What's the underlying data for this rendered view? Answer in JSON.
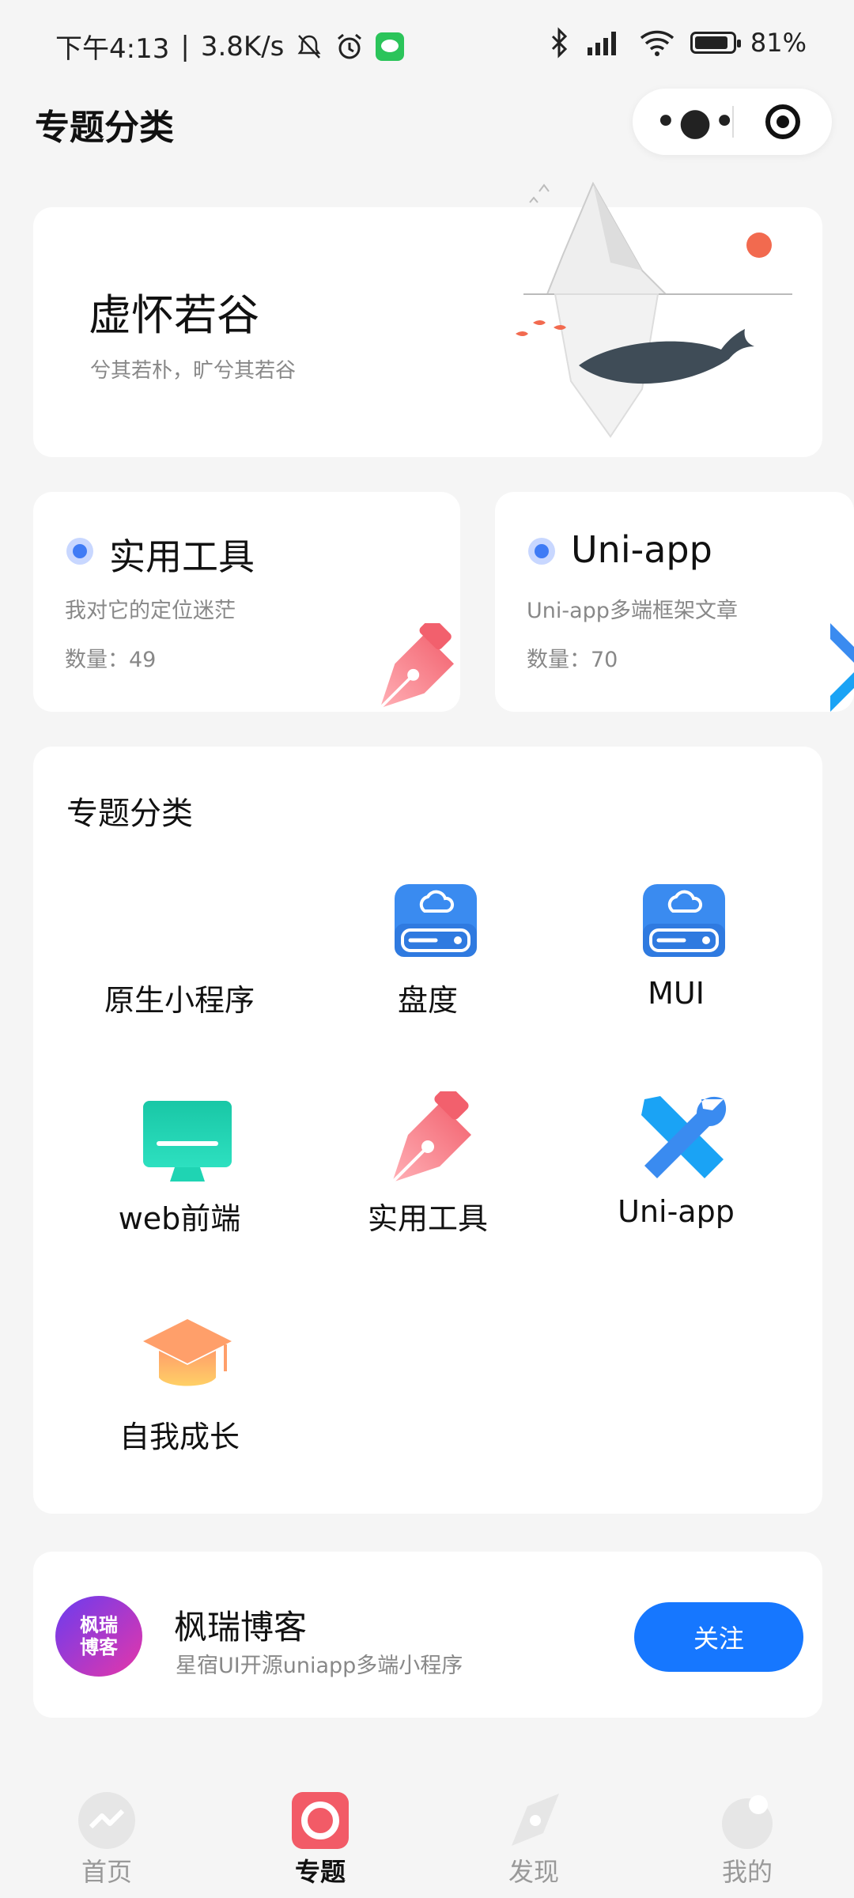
{
  "status_bar": {
    "time": "下午4:13",
    "net_speed": "3.8K/s",
    "battery": "81%"
  },
  "header": {
    "title": "专题分类",
    "capsule_menu_icon": "more-dots-icon",
    "capsule_close_icon": "target-icon"
  },
  "hero": {
    "title": "虚怀若谷",
    "subtitle": "兮其若朴，旷兮其若谷",
    "illustration": "iceberg-whale"
  },
  "featured": [
    {
      "name": "实用工具",
      "desc": "我对它的定位迷茫",
      "count": "数量：49",
      "icon": "pen-icon"
    },
    {
      "name": "Uni-app",
      "desc": "Uni-app多端框架文章",
      "count": "数量：70",
      "icon": "tools-icon"
    }
  ],
  "topics": {
    "title": "专题分类",
    "items": [
      {
        "label": "原生小程序",
        "icon": "none"
      },
      {
        "label": "盘度",
        "icon": "cloud-drive-icon"
      },
      {
        "label": "MUI",
        "icon": "cloud-drive-icon"
      },
      {
        "label": "web前端",
        "icon": "monitor-icon"
      },
      {
        "label": "实用工具",
        "icon": "pen-icon"
      },
      {
        "label": "Uni-app",
        "icon": "tools-icon"
      },
      {
        "label": "自我成长",
        "icon": "graduation-cap-icon"
      }
    ]
  },
  "follow": {
    "name": "枫瑞博客",
    "desc": "星宿UI开源uniapp多端小程序",
    "avatar_text_1": "枫瑞",
    "avatar_text_2": "博客",
    "button": "关注"
  },
  "tabbar": [
    {
      "label": "首页",
      "active": false
    },
    {
      "label": "专题",
      "active": true
    },
    {
      "label": "发现",
      "active": false
    },
    {
      "label": "我的",
      "active": false
    }
  ],
  "colors": {
    "accent": "#1677ff",
    "active_tab": "#f25b67"
  }
}
